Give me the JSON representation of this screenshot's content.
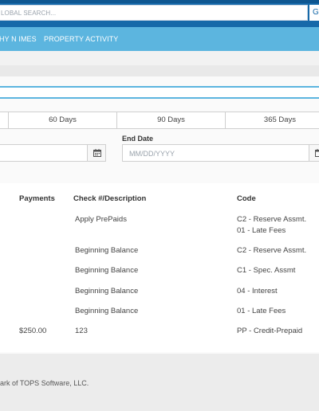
{
  "colors": {
    "topbar": "#1669a9",
    "navbar": "#5cb5df",
    "accent": "#5cb5df"
  },
  "header": {
    "search_placeholder": "LOBAL SEARCH...",
    "search_button": "G"
  },
  "nav": {
    "items": [
      {
        "label": "HY N IMES"
      },
      {
        "label": "PROPERTY ACTIVITY"
      }
    ]
  },
  "filters": {
    "ranges": [
      {
        "label": "60 Days"
      },
      {
        "label": "90 Days"
      },
      {
        "label": "365 Days"
      }
    ],
    "end_date_label": "End Date",
    "end_date_placeholder": "MM/DD/YYYY",
    "calendar_icon": "calendar-icon"
  },
  "table": {
    "columns": [
      "Payments",
      "Check #/Description",
      "Code"
    ],
    "rows": [
      {
        "payment": "",
        "description": "Apply PrePaids",
        "code": "C2 - Reserve Assmt.",
        "code2": "01 - Late Fees"
      },
      {
        "payment": "",
        "description": "Beginning Balance",
        "code": "C2 - Reserve Assmt."
      },
      {
        "payment": "",
        "description": "Beginning Balance",
        "code": "C1 - Spec. Assmt"
      },
      {
        "payment": "",
        "description": "Beginning Balance",
        "code": "04 - Interest"
      },
      {
        "payment": "",
        "description": "Beginning Balance",
        "code": "01 - Late Fees"
      },
      {
        "payment": "$250.00",
        "description": "123",
        "code": "PP - Credit-Prepaid"
      }
    ]
  },
  "footer": {
    "text": "ark of TOPS Software, LLC."
  }
}
